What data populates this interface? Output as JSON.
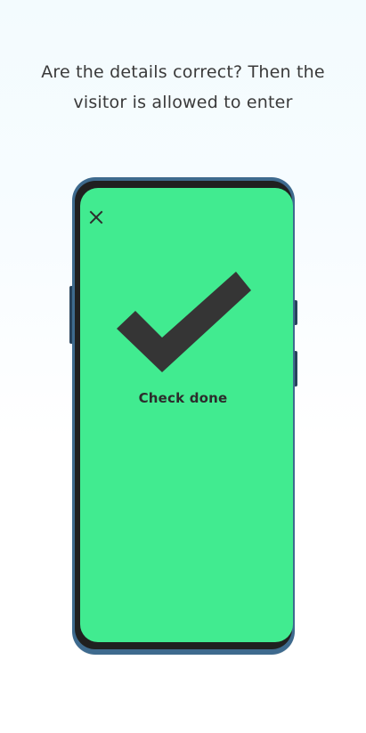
{
  "instruction": {
    "line1": "Are the details correct? Then the",
    "line2": "visitor is allowed to enter"
  },
  "screen": {
    "background_color": "#41eb90",
    "close_icon": "close-icon",
    "check_icon": "checkmark-icon",
    "status_text": "Check done"
  },
  "phone": {
    "frame_color": "#3e6a8e"
  }
}
